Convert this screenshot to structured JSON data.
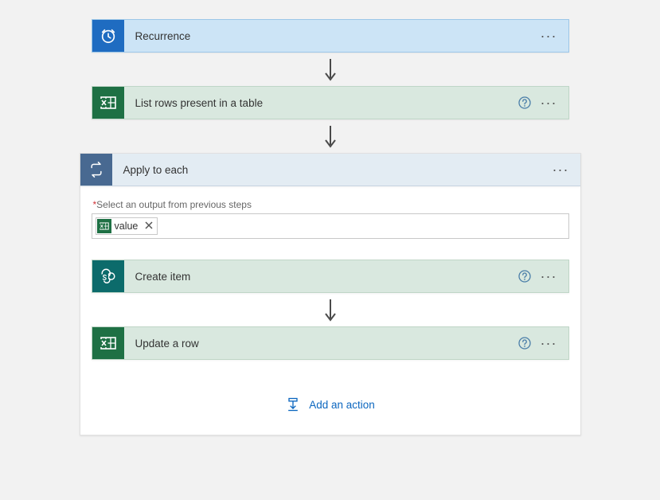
{
  "steps": {
    "recurrence": {
      "title": "Recurrence"
    },
    "listRows": {
      "title": "List rows present in a table"
    },
    "applyEach": {
      "title": "Apply to each",
      "inputLabel": "Select an output from previous steps",
      "tokenLabel": "value"
    },
    "createItem": {
      "title": "Create item"
    },
    "updateRow": {
      "title": "Update a row"
    }
  },
  "addAction": "Add an action",
  "colors": {
    "azure": "#1f6cc1",
    "excel": "#1e7044",
    "sharepoint": "#0c6b6b",
    "loop": "#486991",
    "link": "#0b66bf"
  }
}
